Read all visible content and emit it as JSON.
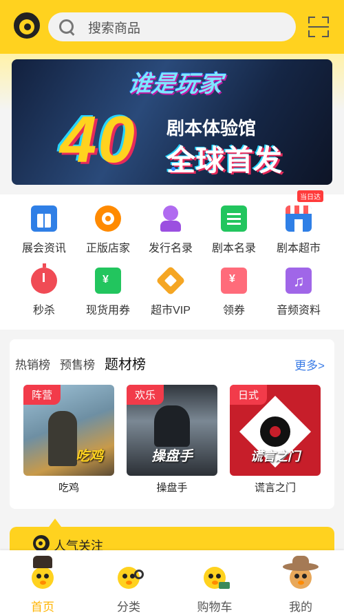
{
  "search": {
    "placeholder": "搜索商品"
  },
  "banner": {
    "title": "谁是玩家",
    "number": "40",
    "line1": "剧本体验馆",
    "line2": "全球首发"
  },
  "categories": [
    {
      "label": "展会资讯",
      "icon": "exhibition-icon",
      "color": "#2f7fe6"
    },
    {
      "label": "正版店家",
      "icon": "store-logo-icon",
      "color": "#ff8a00"
    },
    {
      "label": "发行名录",
      "icon": "publisher-user-icon",
      "color": "#9b4fe0"
    },
    {
      "label": "剧本名录",
      "icon": "script-clipboard-icon",
      "color": "#22c55e"
    },
    {
      "label": "剧本超市",
      "icon": "supermarket-icon",
      "color": "#2f7fe6",
      "badge": "当日达"
    },
    {
      "label": "秒杀",
      "icon": "stopwatch-icon",
      "color": "#f04b55"
    },
    {
      "label": "现货用券",
      "icon": "coupon-ticket-icon",
      "color": "#22c55e"
    },
    {
      "label": "超市VIP",
      "icon": "vip-crown-icon",
      "color": "#f5a623"
    },
    {
      "label": "领券",
      "icon": "red-envelope-icon",
      "color": "#ff6b7a"
    },
    {
      "label": "音频资料",
      "icon": "music-note-icon",
      "color": "#a066e8"
    }
  ],
  "ranking": {
    "tabs": [
      "热销榜",
      "预售榜",
      "题材榜"
    ],
    "active_tab": "题材榜",
    "more": "更多>",
    "items": [
      {
        "tag": "阵营",
        "name": "吃鸡",
        "cover_text": "吃鸡"
      },
      {
        "tag": "欢乐",
        "name": "操盘手",
        "cover_text": "操盘手"
      },
      {
        "tag": "日式",
        "name": "谎言之门",
        "cover_text": "谎言之门"
      }
    ]
  },
  "popular": {
    "title": "人气关注"
  },
  "nav": [
    {
      "label": "首页",
      "active": true
    },
    {
      "label": "分类",
      "active": false
    },
    {
      "label": "购物车",
      "active": false
    },
    {
      "label": "我的",
      "active": false
    }
  ]
}
